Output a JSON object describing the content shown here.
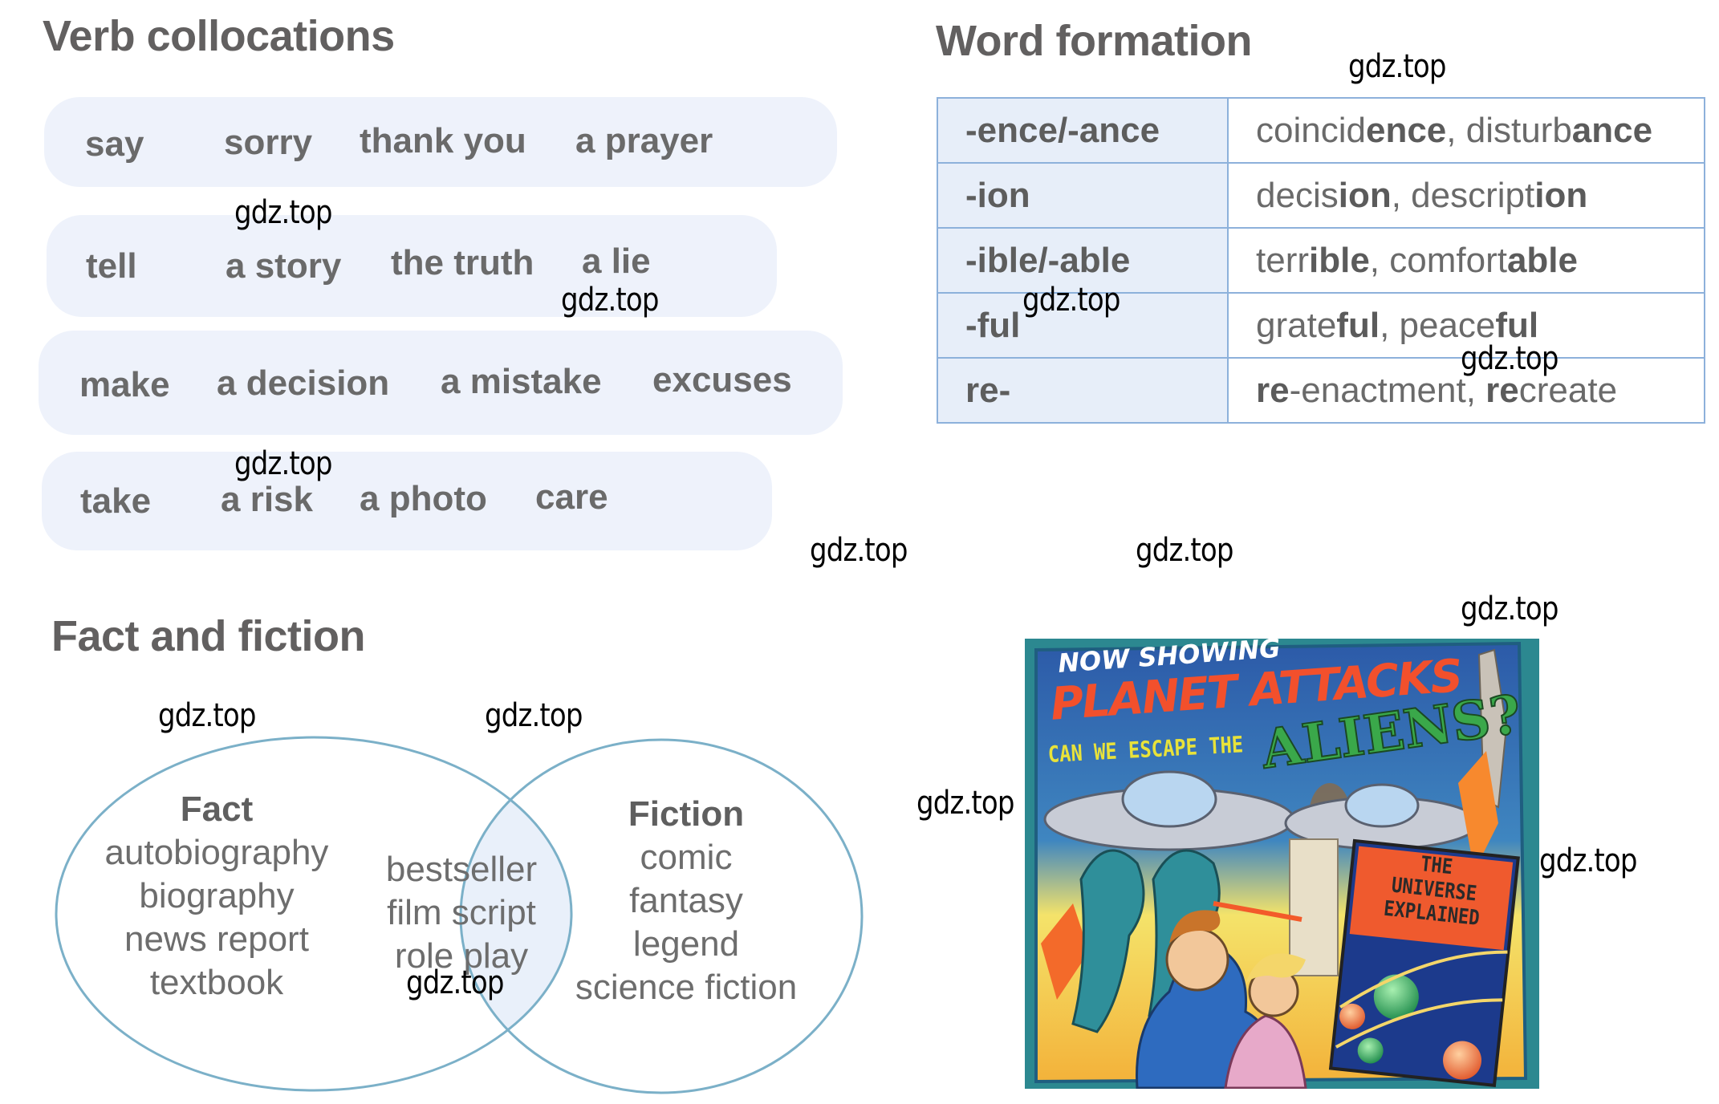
{
  "verb_collocations": {
    "title": "Verb collocations",
    "rows": [
      {
        "verb": "say",
        "collocates": [
          "sorry",
          "thank you",
          "a prayer"
        ]
      },
      {
        "verb": "tell",
        "collocates": [
          "a story",
          "the truth",
          "a lie"
        ]
      },
      {
        "verb": "make",
        "collocates": [
          "a decision",
          "a mistake",
          "excuses"
        ]
      },
      {
        "verb": "take",
        "collocates": [
          "a risk",
          "a photo",
          "care"
        ]
      }
    ]
  },
  "word_formation": {
    "title": "Word formation",
    "rows": [
      {
        "suffix": "-ence/-ance",
        "examples": [
          [
            "coincid",
            "ence"
          ],
          [
            "disturb",
            "ance"
          ]
        ]
      },
      {
        "suffix": "-ion",
        "examples": [
          [
            "decis",
            "ion"
          ],
          [
            "descript",
            "ion"
          ]
        ]
      },
      {
        "suffix": "-ible/-able",
        "examples": [
          [
            "terr",
            "ible"
          ],
          [
            "comfort",
            "able"
          ]
        ]
      },
      {
        "suffix": "-ful",
        "examples": [
          [
            "grate",
            "ful"
          ],
          [
            "peace",
            "ful"
          ]
        ]
      },
      {
        "suffix": "re-",
        "examples": [
          [
            "re",
            "-enactment"
          ],
          [
            "re",
            "create"
          ]
        ]
      }
    ]
  },
  "fact_and_fiction": {
    "title": "Fact and fiction",
    "fact": {
      "heading": "Fact",
      "items": [
        "autobiography",
        "biography",
        "news report",
        "textbook"
      ]
    },
    "both": {
      "items": [
        "bestseller",
        "film script",
        "role play"
      ]
    },
    "fiction": {
      "heading": "Fiction",
      "items": [
        "comic",
        "fantasy",
        "legend",
        "science fiction"
      ]
    },
    "colors": {
      "circle_stroke": "#7bb0c8",
      "overlap_fill": "#e9f0fa"
    }
  },
  "poster": {
    "line1": "NOW SHOWING",
    "line2": "PLANET ATTACKS",
    "line3": "CAN WE ESCAPE THE",
    "line4": "ALIENS?",
    "dvd_title": [
      "THE",
      "UNIVERSE",
      "EXPLAINED"
    ]
  },
  "watermark": "gdz.top"
}
